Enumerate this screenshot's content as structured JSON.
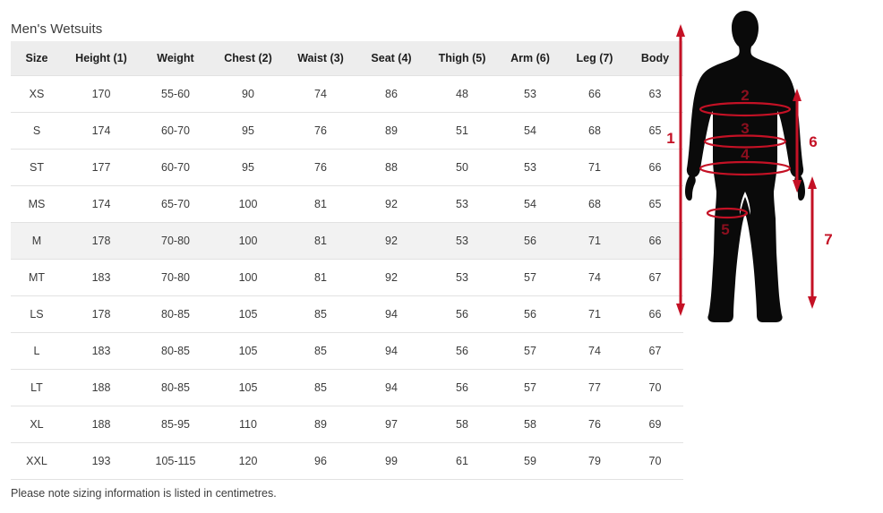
{
  "page": {
    "title": "Men's Wetsuits",
    "note": "Please note sizing information is listed in centimetres."
  },
  "table": {
    "columns": [
      {
        "key": "size",
        "label": "Size"
      },
      {
        "key": "height",
        "label": "Height (1)"
      },
      {
        "key": "weight",
        "label": "Weight"
      },
      {
        "key": "chest",
        "label": "Chest (2)"
      },
      {
        "key": "waist",
        "label": "Waist (3)"
      },
      {
        "key": "seat",
        "label": "Seat (4)"
      },
      {
        "key": "thigh",
        "label": "Thigh (5)"
      },
      {
        "key": "arm",
        "label": "Arm (6)"
      },
      {
        "key": "leg",
        "label": "Leg (7)"
      },
      {
        "key": "body",
        "label": "Body"
      }
    ],
    "rows": [
      {
        "size": "XS",
        "height": "170",
        "weight": "55-60",
        "chest": "90",
        "waist": "74",
        "seat": "86",
        "thigh": "48",
        "arm": "53",
        "leg": "66",
        "body": "63",
        "highlighted": false
      },
      {
        "size": "S",
        "height": "174",
        "weight": "60-70",
        "chest": "95",
        "waist": "76",
        "seat": "89",
        "thigh": "51",
        "arm": "54",
        "leg": "68",
        "body": "65",
        "highlighted": false
      },
      {
        "size": "ST",
        "height": "177",
        "weight": "60-70",
        "chest": "95",
        "waist": "76",
        "seat": "88",
        "thigh": "50",
        "arm": "53",
        "leg": "71",
        "body": "66",
        "highlighted": false
      },
      {
        "size": "MS",
        "height": "174",
        "weight": "65-70",
        "chest": "100",
        "waist": "81",
        "seat": "92",
        "thigh": "53",
        "arm": "54",
        "leg": "68",
        "body": "65",
        "highlighted": false
      },
      {
        "size": "M",
        "height": "178",
        "weight": "70-80",
        "chest": "100",
        "waist": "81",
        "seat": "92",
        "thigh": "53",
        "arm": "56",
        "leg": "71",
        "body": "66",
        "highlighted": true
      },
      {
        "size": "MT",
        "height": "183",
        "weight": "70-80",
        "chest": "100",
        "waist": "81",
        "seat": "92",
        "thigh": "53",
        "arm": "57",
        "leg": "74",
        "body": "67",
        "highlighted": false
      },
      {
        "size": "LS",
        "height": "178",
        "weight": "80-85",
        "chest": "105",
        "waist": "85",
        "seat": "94",
        "thigh": "56",
        "arm": "56",
        "leg": "71",
        "body": "66",
        "highlighted": false
      },
      {
        "size": "L",
        "height": "183",
        "weight": "80-85",
        "chest": "105",
        "waist": "85",
        "seat": "94",
        "thigh": "56",
        "arm": "57",
        "leg": "74",
        "body": "67",
        "highlighted": false
      },
      {
        "size": "LT",
        "height": "188",
        "weight": "80-85",
        "chest": "105",
        "waist": "85",
        "seat": "94",
        "thigh": "56",
        "arm": "57",
        "leg": "77",
        "body": "70",
        "highlighted": false
      },
      {
        "size": "XL",
        "height": "188",
        "weight": "85-95",
        "chest": "110",
        "waist": "89",
        "seat": "97",
        "thigh": "58",
        "arm": "58",
        "leg": "76",
        "body": "69",
        "highlighted": false
      },
      {
        "size": "XXL",
        "height": "193",
        "weight": "105-115",
        "chest": "120",
        "waist": "96",
        "seat": "99",
        "thigh": "61",
        "arm": "59",
        "leg": "79",
        "body": "70",
        "highlighted": false
      }
    ]
  },
  "diagram": {
    "name": "male-body-measurement-diagram",
    "silhouette_color": "#0a0a0a",
    "marker_color": "#c41125",
    "marker_color_inner": "#8c0f1e",
    "markers": [
      {
        "id": "1",
        "label": "1",
        "measures": "Height",
        "style": "double-arrow-vertical"
      },
      {
        "id": "2",
        "label": "2",
        "measures": "Chest",
        "style": "ellipse-band"
      },
      {
        "id": "3",
        "label": "3",
        "measures": "Waist",
        "style": "ellipse-band"
      },
      {
        "id": "4",
        "label": "4",
        "measures": "Seat",
        "style": "ellipse-band"
      },
      {
        "id": "5",
        "label": "5",
        "measures": "Thigh",
        "style": "ellipse-band"
      },
      {
        "id": "6",
        "label": "6",
        "measures": "Arm",
        "style": "double-arrow-vertical"
      },
      {
        "id": "7",
        "label": "7",
        "measures": "Leg",
        "style": "double-arrow-vertical"
      }
    ]
  }
}
